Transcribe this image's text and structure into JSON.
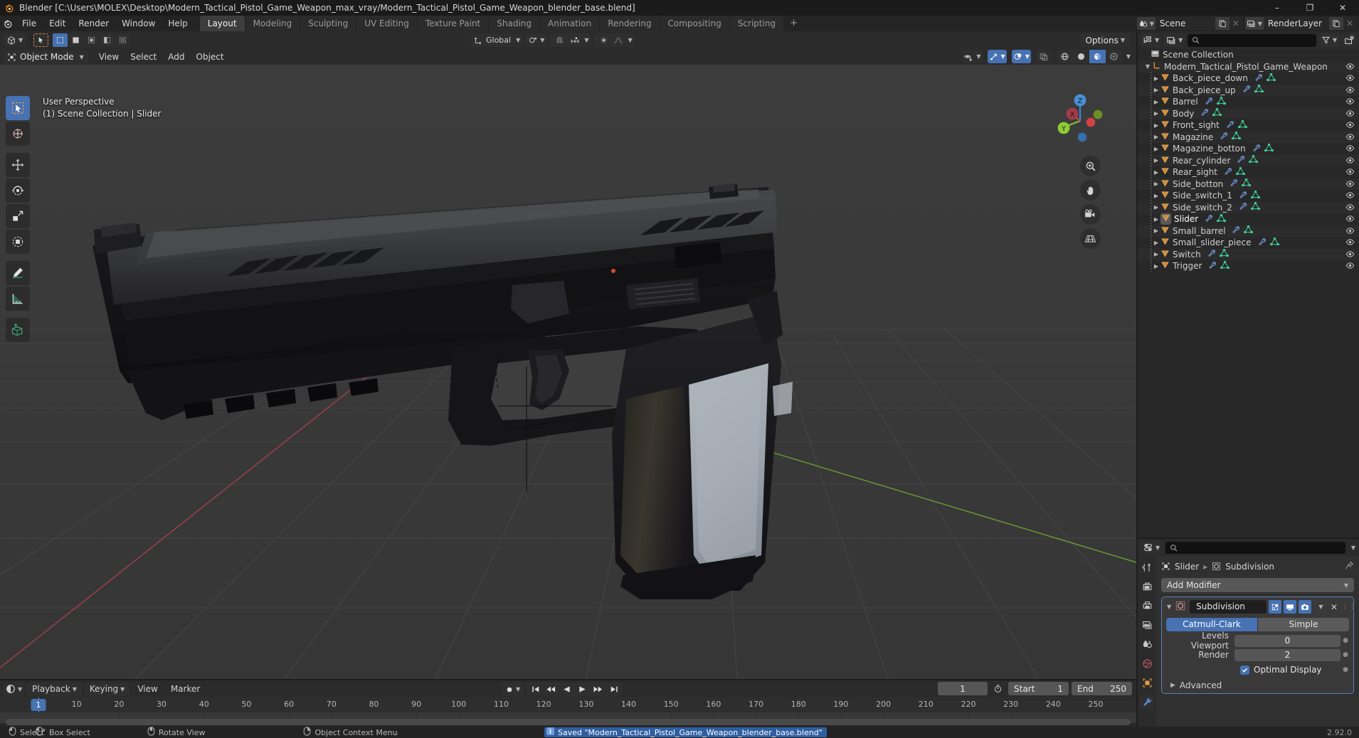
{
  "titlebar": {
    "title": "Blender [C:\\Users\\MOLEX\\Desktop\\Modern_Tactical_Pistol_Game_Weapon_max_vray/Modern_Tactical_Pistol_Game_Weapon_blender_base.blend]",
    "minimize": "–",
    "maximize": "❐",
    "close": "✕"
  },
  "topbar": {
    "menus": [
      "File",
      "Edit",
      "Render",
      "Window",
      "Help"
    ],
    "workspaces": [
      {
        "label": "Layout",
        "active": true
      },
      {
        "label": "Modeling",
        "active": false
      },
      {
        "label": "Sculpting",
        "active": false
      },
      {
        "label": "UV Editing",
        "active": false
      },
      {
        "label": "Texture Paint",
        "active": false
      },
      {
        "label": "Shading",
        "active": false
      },
      {
        "label": "Animation",
        "active": false
      },
      {
        "label": "Rendering",
        "active": false
      },
      {
        "label": "Compositing",
        "active": false
      },
      {
        "label": "Scripting",
        "active": false
      }
    ],
    "add_workspace": "+",
    "scene_name": "Scene",
    "viewlayer_name": "RenderLayer"
  },
  "viewport": {
    "transform_orientation": "Global",
    "mode": "Object Mode",
    "menus": [
      "View",
      "Select",
      "Add",
      "Object"
    ],
    "options_label": "Options",
    "overlay_line1": "User Perspective",
    "overlay_line2": "(1) Scene Collection | Slider",
    "gizmo_axes": [
      "X",
      "Y",
      "Z"
    ],
    "tools": [
      "tweak-select-tool",
      "cursor-tool",
      "move-tool",
      "rotate-tool",
      "scale-tool",
      "transform-tool",
      "annotate-tool",
      "measure-tool",
      "add-cube-tool"
    ]
  },
  "outliner": {
    "root": "Scene Collection",
    "collection": "Modern_Tactical_Pistol_Game_Weapon",
    "objects": [
      {
        "name": "Back_piece_down",
        "selected": false
      },
      {
        "name": "Back_piece_up",
        "selected": false
      },
      {
        "name": "Barrel",
        "selected": false
      },
      {
        "name": "Body",
        "selected": false
      },
      {
        "name": "Front_sight",
        "selected": false
      },
      {
        "name": "Magazine",
        "selected": false
      },
      {
        "name": "Magazine_botton",
        "selected": false
      },
      {
        "name": "Rear_cylinder",
        "selected": false
      },
      {
        "name": "Rear_sight",
        "selected": false
      },
      {
        "name": "Side_botton",
        "selected": false
      },
      {
        "name": "Side_switch_1",
        "selected": false
      },
      {
        "name": "Side_switch_2",
        "selected": false
      },
      {
        "name": "Slider",
        "selected": true
      },
      {
        "name": "Small_barrel",
        "selected": false
      },
      {
        "name": "Small_slider_piece",
        "selected": false
      },
      {
        "name": "Switch",
        "selected": false
      },
      {
        "name": "Trigger",
        "selected": false
      }
    ]
  },
  "properties": {
    "breadcrumb_object": "Slider",
    "breadcrumb_modifier": "Subdivision",
    "add_modifier": "Add Modifier",
    "modifier": {
      "name": "Subdivision",
      "type_options": [
        {
          "label": "Catmull-Clark",
          "active": true
        },
        {
          "label": "Simple",
          "active": false
        }
      ],
      "levels_viewport_label": "Levels Viewport",
      "levels_viewport_value": "0",
      "render_label": "Render",
      "render_value": "2",
      "optimal_display_label": "Optimal Display",
      "optimal_display_checked": true,
      "advanced_label": "Advanced"
    }
  },
  "timeline": {
    "menus": [
      "Playback",
      "Keying",
      "View",
      "Marker"
    ],
    "current_frame": "1",
    "start_label": "Start",
    "start_value": "1",
    "end_label": "End",
    "end_value": "250",
    "ticks": [
      10,
      20,
      30,
      40,
      50,
      60,
      70,
      80,
      90,
      100,
      110,
      120,
      130,
      140,
      150,
      160,
      170,
      180,
      190,
      200,
      210,
      220,
      230,
      240,
      250
    ],
    "playhead_frame": 1
  },
  "statusbar": {
    "hints": [
      {
        "icon": "mouse-left-icon",
        "label": "Select"
      },
      {
        "icon": "mouse-drag-icon",
        "label": "Box Select"
      },
      {
        "icon": "mouse-middle-icon",
        "label": "Rotate View"
      },
      {
        "icon": "mouse-right-icon",
        "label": "Object Context Menu"
      }
    ],
    "report": "Saved \"Modern_Tactical_Pistol_Game_Weapon_blender_base.blend\"",
    "version": "2.92.0"
  },
  "colors": {
    "accent": "#4772b3",
    "viewport_bg": "#393939",
    "header_bg": "#2b2b2b",
    "panel_bg": "#303030",
    "outliner_bg": "#282828",
    "object_orange": "#e5962e",
    "mesh_green": "#3fd6a0",
    "modifier_blue": "#6e93d6",
    "axis_x": "#a83d4c",
    "axis_y": "#7fb03d",
    "status_blue": "#2e5fa3"
  }
}
